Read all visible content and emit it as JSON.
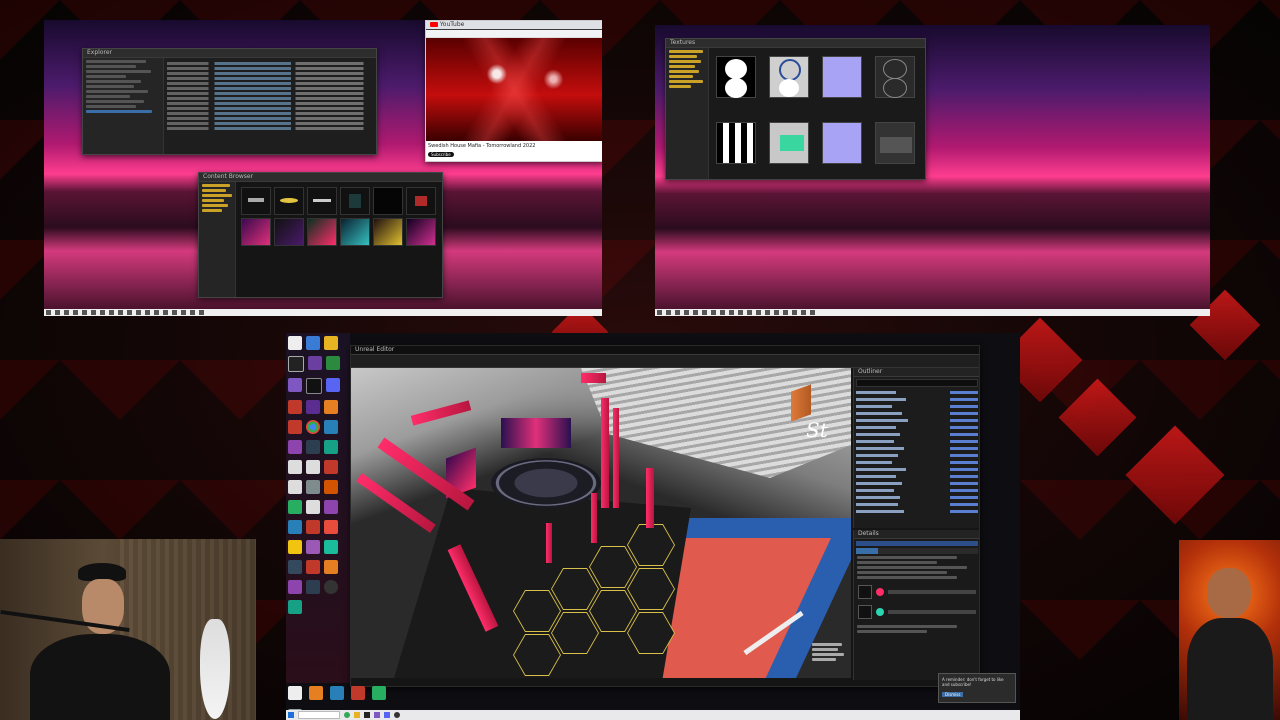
{
  "monitor_left": {
    "explorer_window": {
      "title": "Explorer"
    },
    "browser_window": {
      "title": "YouTube",
      "video_title": "Swedish House Mafia - Tomorrowland 2022",
      "subscribe_label": "Subscribe"
    },
    "asset_window": {
      "title": "Content Browser"
    }
  },
  "monitor_right": {
    "texture_window": {
      "title": "Textures"
    }
  },
  "editor": {
    "title": "Unreal Editor",
    "outliner_title": "Outliner",
    "details_title": "Details",
    "arena_sign": "St"
  },
  "notification": {
    "text": "A reminder: don't forget to like and subscribe!",
    "action": "Dismiss"
  },
  "colors": {
    "accent_pink": "#ff2d6a",
    "court_red": "#e05a4e",
    "court_blue": "#2a5fb0",
    "hex_border": "#d8c04a"
  },
  "icons": [
    "windows-start-icon",
    "search-icon",
    "chrome-icon",
    "folder-icon",
    "unreal-icon",
    "visual-studio-icon",
    "discord-icon",
    "obs-icon"
  ]
}
